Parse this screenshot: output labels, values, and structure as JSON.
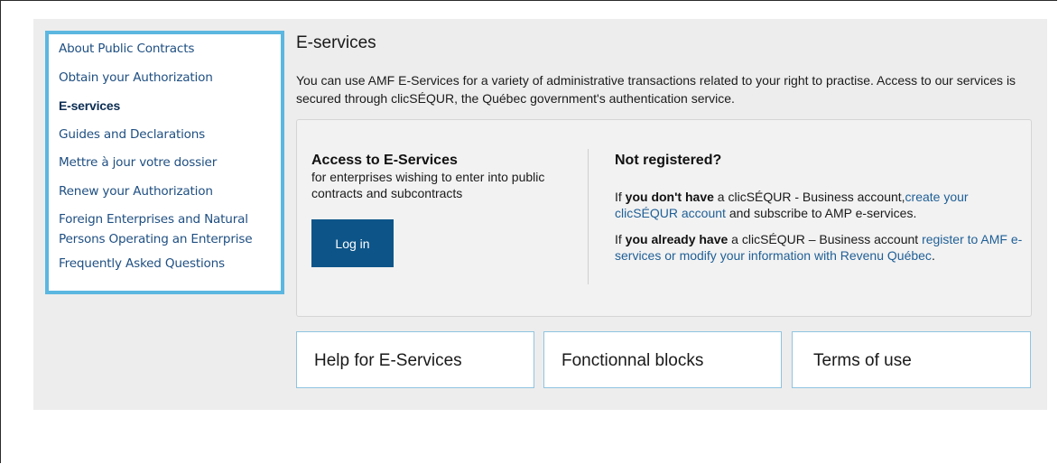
{
  "sidebar": {
    "items": [
      {
        "label": "About Public Contracts"
      },
      {
        "label": "Obtain your Authorization"
      },
      {
        "label": "E-services"
      },
      {
        "label": "Guides and Declarations"
      },
      {
        "label": "Mettre à jour votre dossier"
      },
      {
        "label": "Renew your Authorization"
      },
      {
        "label": "Foreign Enterprises and Natural Persons Operating an Enterprise"
      },
      {
        "label": "Frequently Asked Questions"
      }
    ],
    "active": "E-services"
  },
  "main": {
    "title": "E-services",
    "intro": "You can use AMF E-Services for a variety of administrative transactions related to your right to practise. Access to our services is secured through clicSÉQUR, the Québec government's authentication service.",
    "access": {
      "heading": "Access to E-Services",
      "subtitle": "for enterprises wishing to enter into public contracts and subcontracts",
      "login_label": "Log in"
    },
    "register": {
      "heading": "Not registered?",
      "p1": {
        "prefix": "If ",
        "bold": "you don't have",
        "middle": " a clicSÉQUR - Business account,",
        "link": "create your clicSÉQUR account",
        "suffix": " and subscribe to AMP e-services."
      },
      "p2": {
        "prefix": "If ",
        "bold": "you already have",
        "middle": " a clicSÉQUR – Business account ",
        "link": "register to AMF e-services or modify your information with Revenu Québec",
        "suffix": "."
      }
    },
    "tiles": [
      {
        "label": "Help for E-Services"
      },
      {
        "label": "Fonctionnal blocks"
      },
      {
        "label": "Terms of use"
      }
    ]
  },
  "colors": {
    "sidebar_border": "#5bb7e0",
    "link": "#1f5f96",
    "button": "#0d5589",
    "panel_bg": "#ededed"
  }
}
